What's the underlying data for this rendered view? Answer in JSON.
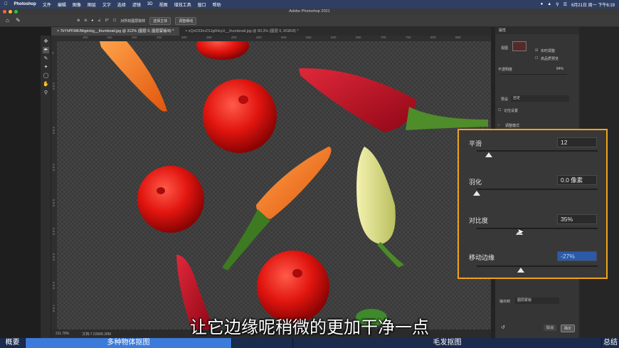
{
  "menubar": {
    "app_name": "Photoshop",
    "items": [
      "文件",
      "编辑",
      "图像",
      "图层",
      "文字",
      "选择",
      "滤镜",
      "3D",
      "视图",
      "增效工具",
      "窗口",
      "帮助"
    ],
    "datetime": "6月21日 周一 下午6:19"
  },
  "window": {
    "title": "Adobe Photoshop 2021"
  },
  "options_bar": {
    "angle": "0°",
    "sample_all_layers": "对所有图层取样",
    "select_subject": "选择主体",
    "select_hair": "调整细线"
  },
  "tabs": [
    {
      "label": "7kYhPFMK/Mqptckg__thumbnail.jpg @ 312% (图层 0, 图层蒙版/8) *"
    },
    {
      "label": "xQnO33mZSJg6hkyU__thumbnail.jpg @ 80.3% (图层 0, RGB/8) *"
    }
  ],
  "ruler": {
    "h_ticks": [
      "100",
      "150",
      "200",
      "250",
      "300",
      "350",
      "400",
      "450",
      "500",
      "550",
      "600",
      "650",
      "700",
      "750",
      "800",
      "850",
      "900",
      "950"
    ],
    "v_ticks": [
      "3",
      "3 5 0",
      "4 0 0",
      "4 5 0",
      "5 0 0",
      "5 5 0",
      "6 0 0",
      "6 5 0",
      "7 0 0",
      "7 5 0",
      "8 0 0"
    ]
  },
  "status": {
    "zoom": "311.78%",
    "doc": "文档:7.03M/8.28M"
  },
  "properties": {
    "title": "属性",
    "view_label": "视图",
    "realtime": "实时调整",
    "high_quality": "高品质预览",
    "opacity_label": "不透明度",
    "opacity_value": "84%",
    "preset_label": "预设",
    "preset_value": "自定",
    "remember": "记住设置",
    "adjust_mode": "调整模式",
    "output_label": "输出到",
    "output_value": "图层蒙版",
    "cancel": "取消",
    "ok": "确定"
  },
  "refine": {
    "smooth": {
      "label": "平滑",
      "value": "12",
      "level": 0.1
    },
    "feather": {
      "label": "羽化",
      "value": "0.0 像素",
      "level": 0.0
    },
    "contrast": {
      "label": "对比度",
      "value": "35%",
      "level": 0.35
    },
    "shift": {
      "label": "移动边缘",
      "value": "-27%",
      "level": -0.27
    }
  },
  "subtitle": "让它边缘呢稍微的更加干净一点",
  "chapters": [
    {
      "label": "概要"
    },
    {
      "label": "多种物体抠图"
    },
    {
      "label": ""
    },
    {
      "label": "毛发抠图"
    },
    {
      "label": "总结"
    }
  ]
}
